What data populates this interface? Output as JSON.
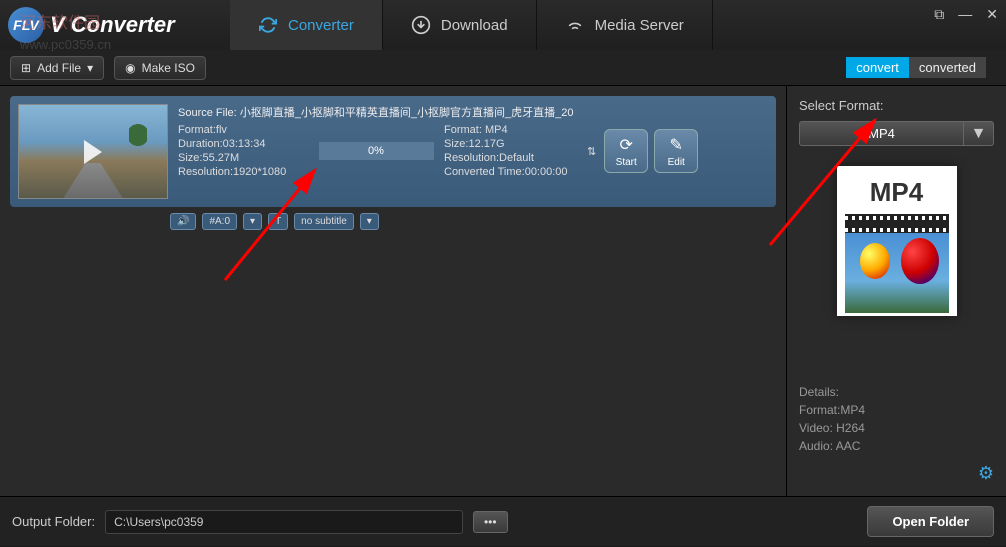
{
  "app": {
    "logo_text": "FLV",
    "title": "V Converter",
    "watermark1": "河东软件园",
    "watermark2": "www.pc0359.cn"
  },
  "tabs": {
    "converter": "Converter",
    "download": "Download",
    "media_server": "Media Server"
  },
  "toolbar": {
    "add_file": "Add File",
    "make_iso": "Make ISO",
    "convert": "convert",
    "converted": "converted"
  },
  "item": {
    "source_label": "Source File:",
    "source_file": "小抠脚直播_小抠脚和平精英直播间_小抠脚官方直播间_虎牙直播_20",
    "left": {
      "format": "Format:flv",
      "duration": "Duration:03:13:34",
      "size": "Size:55.27M",
      "resolution": "Resolution:1920*1080"
    },
    "progress": "0%",
    "right": {
      "format": "Format: MP4",
      "size": "Size:12.17G",
      "resolution": "Resolution:Default",
      "converted_time": "Converted Time:00:00:00"
    },
    "start": "Start",
    "edit": "Edit",
    "audio_track": "#A:0",
    "subtitle": "no subtitle"
  },
  "sidebar": {
    "select_format": "Select Format:",
    "format": "MP4",
    "preview_label": "MP4",
    "details_label": "Details:",
    "details_format": "Format:MP4",
    "details_video": "Video: H264",
    "details_audio": "Audio: AAC"
  },
  "footer": {
    "label": "Output Folder:",
    "path": "C:\\Users\\pc0359",
    "browse": "•••",
    "open_folder": "Open Folder"
  }
}
